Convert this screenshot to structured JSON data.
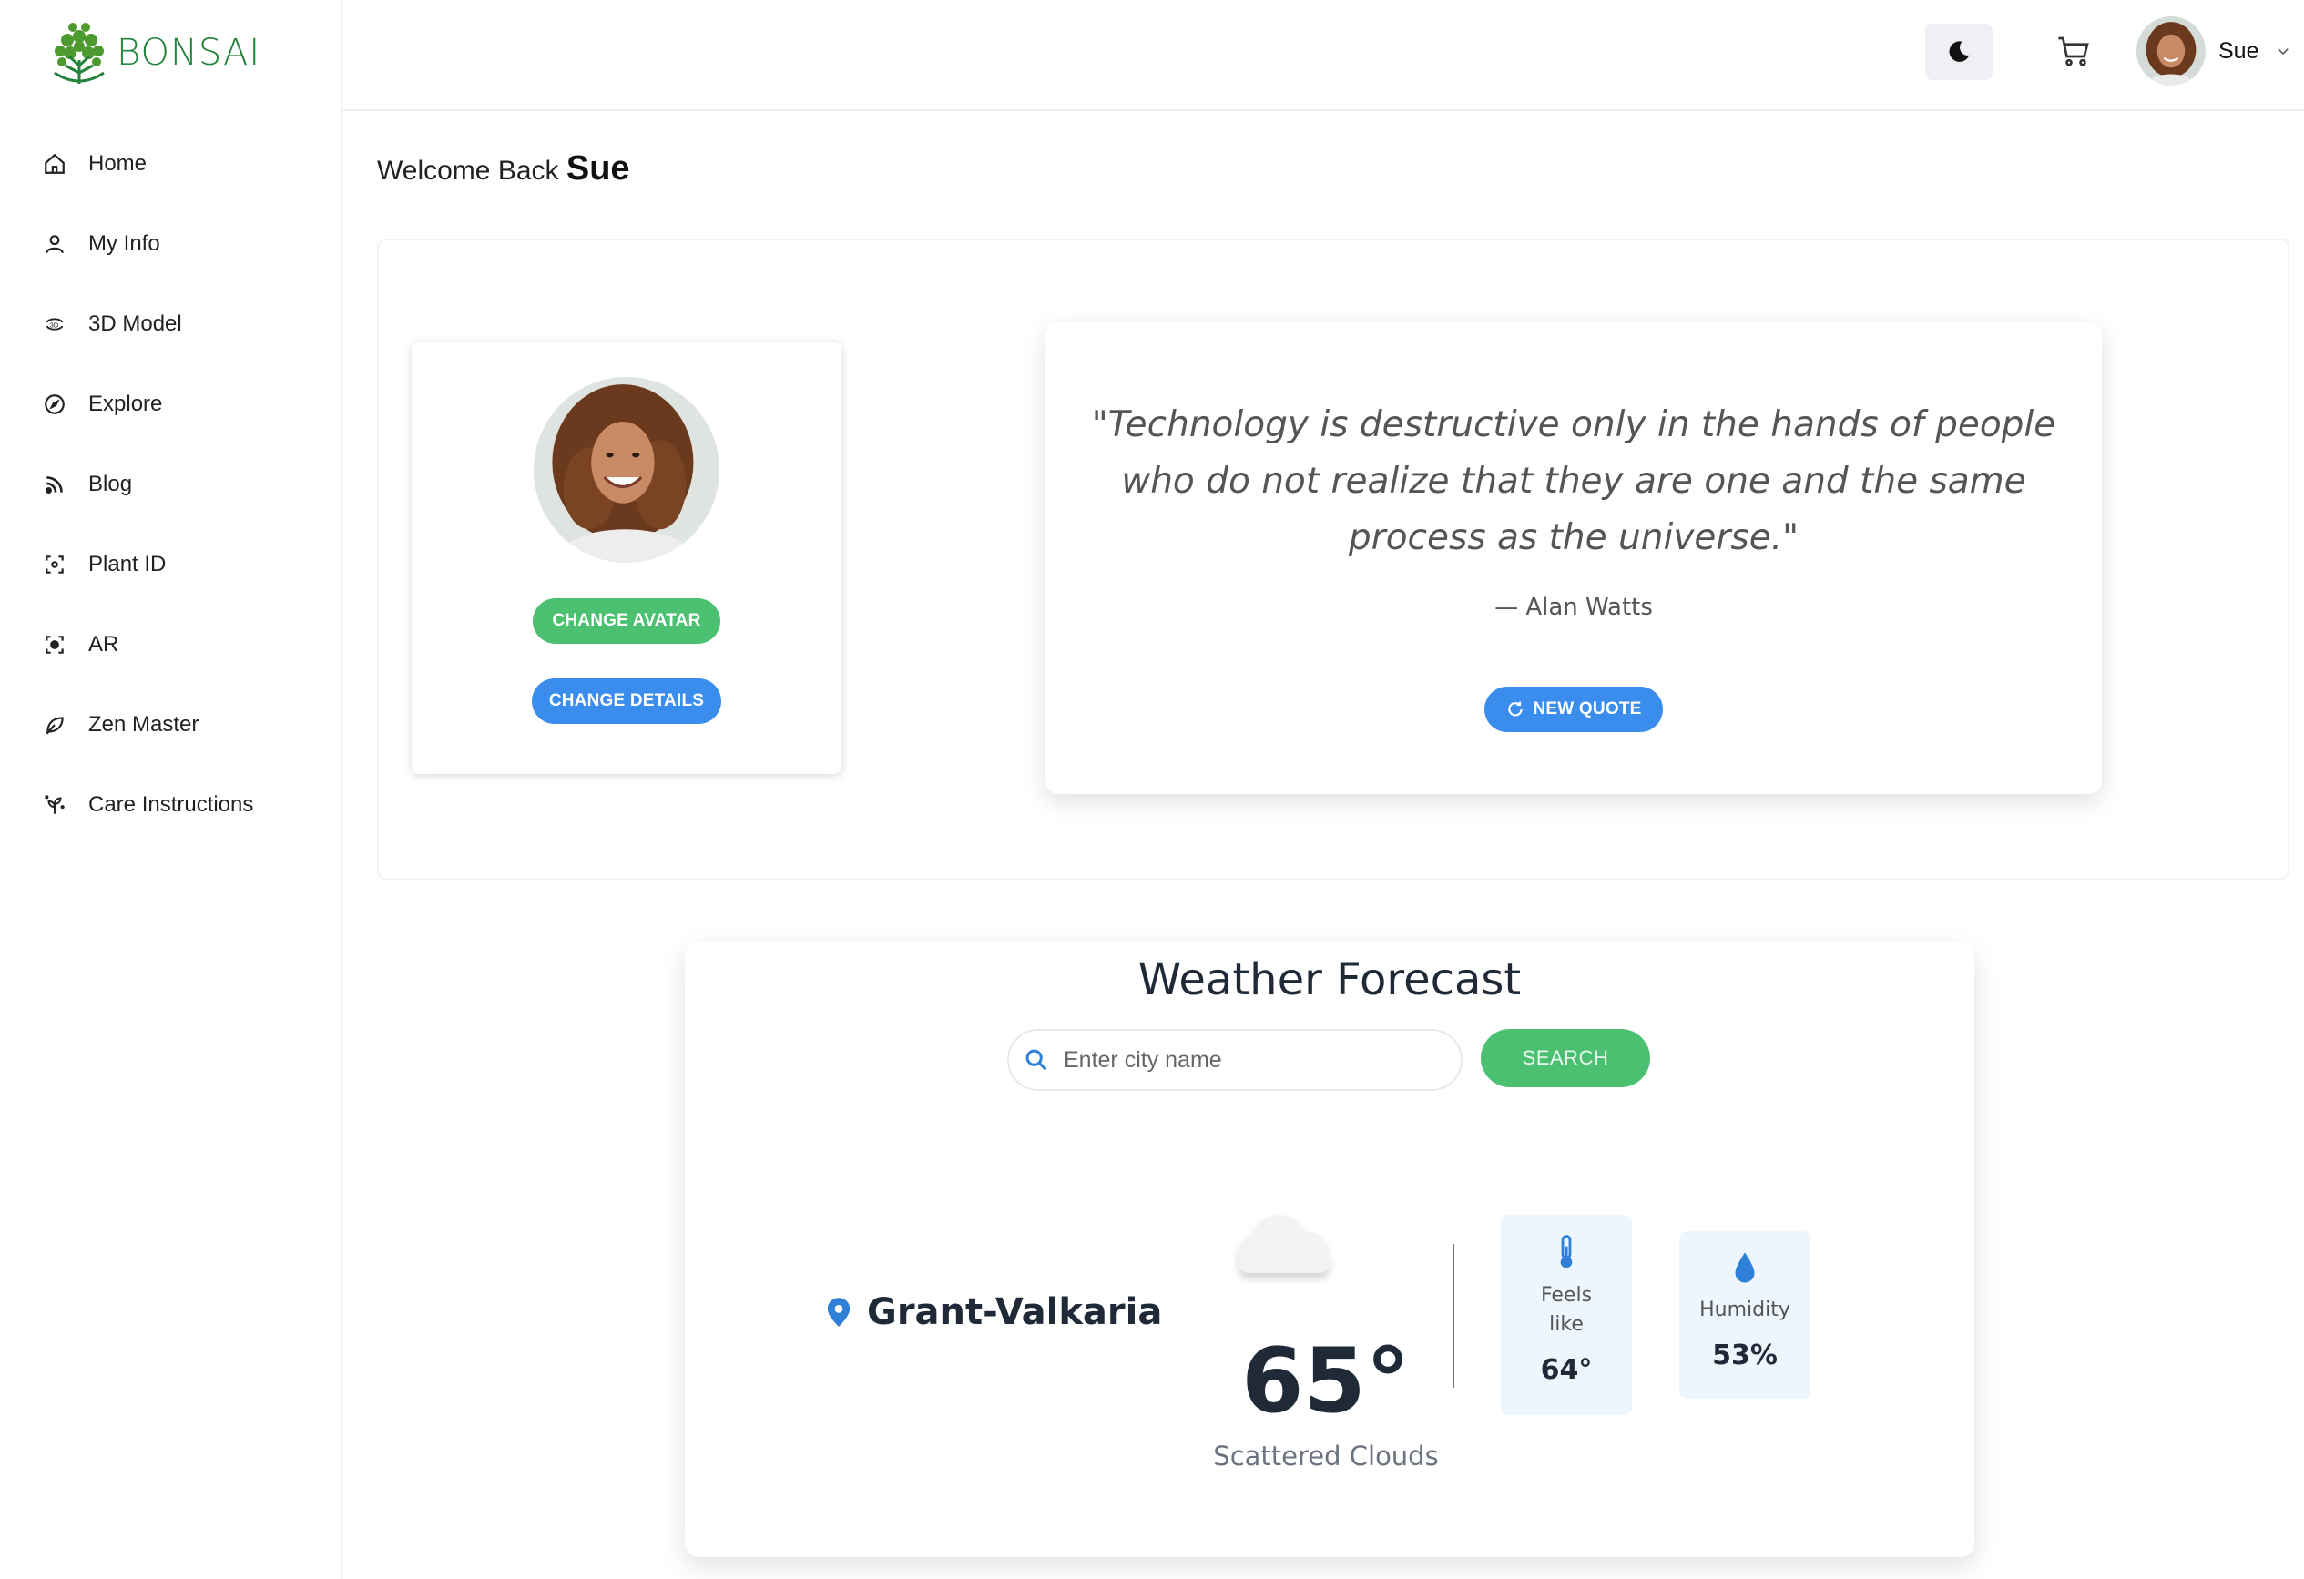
{
  "brand": {
    "name": "BONSAI"
  },
  "sidebar": {
    "items": [
      {
        "label": "Home",
        "icon": "home-icon"
      },
      {
        "label": "My Info",
        "icon": "user-icon"
      },
      {
        "label": "3D Model",
        "icon": "3d-rotate-icon"
      },
      {
        "label": "Explore",
        "icon": "compass-icon"
      },
      {
        "label": "Blog",
        "icon": "rss-icon"
      },
      {
        "label": "Plant ID",
        "icon": "scan-icon"
      },
      {
        "label": "AR",
        "icon": "ar-scan-icon"
      },
      {
        "label": "Zen Master",
        "icon": "leaf-icon"
      },
      {
        "label": "Care Instructions",
        "icon": "sprout-icon"
      }
    ]
  },
  "topbar": {
    "theme_icon": "moon-icon",
    "cart_icon": "cart-icon",
    "user_name": "Sue"
  },
  "welcome": {
    "prefix": "Welcome Back",
    "name": "Sue"
  },
  "profile": {
    "change_avatar_label": "CHANGE AVATAR",
    "change_details_label": "CHANGE DETAILS"
  },
  "quote": {
    "text": "\"Technology is destructive only in the hands of people who do not realize that they are one and the same process as the universe.\"",
    "author": "— Alan Watts",
    "new_quote_label": "NEW QUOTE"
  },
  "weather": {
    "title": "Weather Forecast",
    "search_placeholder": "Enter city name",
    "search_label": "SEARCH",
    "location": "Grant-Valkaria",
    "temperature": "65°",
    "condition": "Scattered Clouds",
    "feels_like_label": "Feels like",
    "feels_like_value": "64°",
    "humidity_label": "Humidity",
    "humidity_value": "53%"
  },
  "colors": {
    "brand_green": "#23833b",
    "button_green": "#4cc071",
    "button_blue": "#3b8ded",
    "stat_bg": "#eef6fd"
  }
}
